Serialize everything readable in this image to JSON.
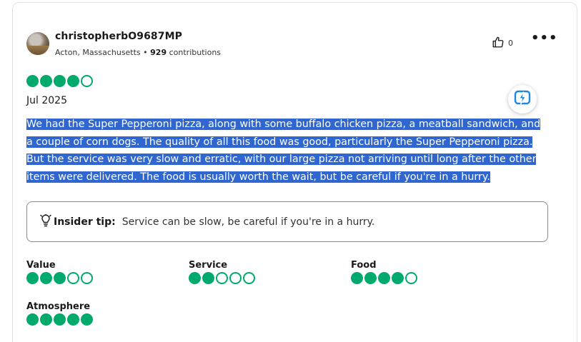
{
  "reviewer": {
    "username": "christopherbO9687MP",
    "location": "Acton, Massachusetts",
    "separator": " • ",
    "contributions_count": "929",
    "contributions_label": " contributions"
  },
  "actions": {
    "helpful_count": "0",
    "more_label": "•••"
  },
  "review": {
    "rating": 4,
    "rating_max": 5,
    "date": "Jul 2025",
    "text": "We had the Super Pepperoni pizza, along with some buffalo chicken pizza, a meatball sandwich, and a couple of corn dogs. The quality of all this food was good, particularly the Super Pepperoni pizza. But the service was very slow and erratic, with our large pizza not arriving until long after the other items were delivered. The food is usually worth the wait, but be careful if you're in a hurry."
  },
  "tip": {
    "label": "Insider tip:",
    "text": "Service can be slow, be careful if you're in a hurry."
  },
  "subratings": [
    {
      "label": "Value",
      "rating": 3
    },
    {
      "label": "Service",
      "rating": 2
    },
    {
      "label": "Food",
      "rating": 4
    },
    {
      "label": "Atmosphere",
      "rating": 5
    }
  ],
  "colors": {
    "bubble_green": "#00aa6c",
    "selection_blue": "#2f66d0",
    "bolt_blue": "#1e88e5"
  },
  "icons": {
    "helpful": "thumbs-up-icon",
    "more": "more-dots-icon",
    "tip": "lightbulb-icon",
    "ai": "lightning-bolt-icon"
  }
}
